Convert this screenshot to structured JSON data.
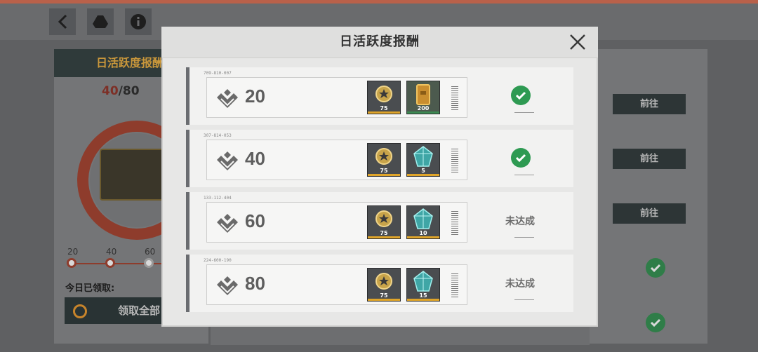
{
  "background": {
    "left_panel_title": "日活跃度报酬",
    "score_current": "40",
    "score_max": "/80",
    "track_labels": [
      "20",
      "40",
      "60"
    ],
    "claimed_label": "今日已领取:",
    "claim_all_label": "领取全部",
    "go_buttons": [
      "前往",
      "前往",
      "前往"
    ],
    "accent_color": "#8e3c2c"
  },
  "modal": {
    "title": "日活跃度报酬",
    "close_icon": "close-icon",
    "rows": [
      {
        "code": "709-810-007",
        "value": "20",
        "rewards": [
          {
            "icon": "medal-icon",
            "qty": "75"
          },
          {
            "icon": "gold-bar-icon",
            "qty": "200"
          }
        ],
        "status": "completed",
        "status_text": ""
      },
      {
        "code": "307-814-053",
        "value": "40",
        "rewards": [
          {
            "icon": "medal-icon",
            "qty": "75"
          },
          {
            "icon": "crystal-icon",
            "qty": "5"
          }
        ],
        "status": "completed",
        "status_text": ""
      },
      {
        "code": "133-112-404",
        "value": "60",
        "rewards": [
          {
            "icon": "medal-icon",
            "qty": "75"
          },
          {
            "icon": "crystal-icon",
            "qty": "10"
          }
        ],
        "status": "incomplete",
        "status_text": "未达成"
      },
      {
        "code": "224-600-190",
        "value": "80",
        "rewards": [
          {
            "icon": "medal-icon",
            "qty": "75"
          },
          {
            "icon": "crystal-icon",
            "qty": "15"
          }
        ],
        "status": "incomplete",
        "status_text": "未达成"
      }
    ]
  },
  "colors": {
    "complete_green": "#2e9a52",
    "reward_stripe": "#e0a52a",
    "top_accent": "#b9614a"
  }
}
